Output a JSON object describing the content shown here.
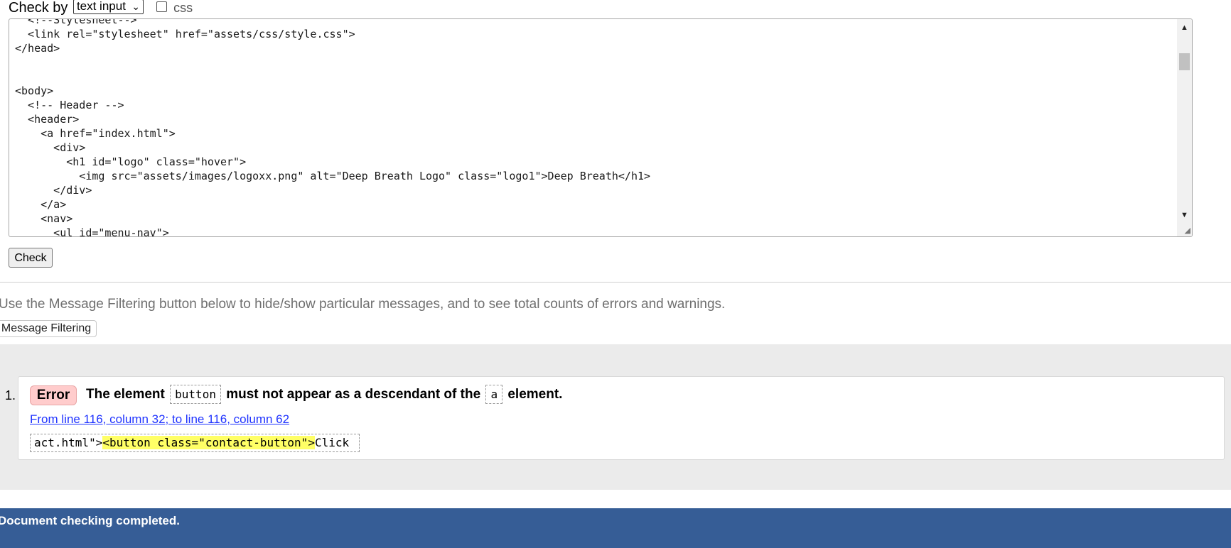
{
  "check_by": {
    "label": "Check by",
    "select_value": "text input",
    "css_label": "css",
    "css_checked": false
  },
  "code_lines": [
    "  <!--Stylesheet-->",
    "  <link rel=\"stylesheet\" href=\"assets/css/style.css\">",
    "</head>",
    "",
    "",
    "<body>",
    "  <!-- Header -->",
    "  <header>",
    "    <a href=\"index.html\">",
    "      <div>",
    "        <h1 id=\"logo\" class=\"hover\">",
    "          <img src=\"assets/images/logoxx.png\" alt=\"Deep Breath Logo\" class=\"logo1\">Deep Breath</h1>",
    "      </div>",
    "    </a>",
    "    <nav>",
    "      <ul id=\"menu-nav\">"
  ],
  "check_button": "Check",
  "filter_hint": "Use the Message Filtering button below to hide/show particular messages, and to see total counts of errors and warnings.",
  "filter_button": "Message Filtering",
  "messages": [
    {
      "number": "1.",
      "type": "Error",
      "text_before": "The element",
      "code1": "button",
      "text_middle": "must not appear as a descendant of the",
      "code2": "a",
      "text_after": "element.",
      "location": "From line 116, column 32; to line 116, column 62",
      "extract_before": "act.html\">",
      "extract_highlight": "<button class=\"contact-button\">",
      "extract_after": "Click"
    }
  ],
  "status": "Document checking completed.",
  "colors": {
    "status_bar": "#365d96",
    "error_badge": "#ffcccc",
    "highlight": "#ffff66",
    "link": "#1f33ff"
  }
}
